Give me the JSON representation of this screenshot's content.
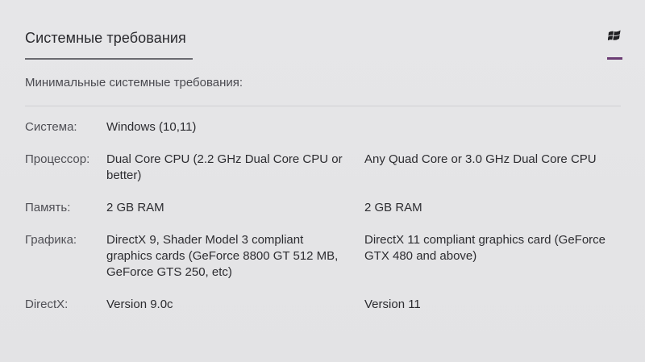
{
  "header": {
    "title": "Системные требования",
    "platform_icon": "windows-icon"
  },
  "colors": {
    "accent": "#6b3c73",
    "title_underline": "#6a6a70",
    "background": "#e4e4e6"
  },
  "subtitle": "Минимальные системные требования:",
  "rows": [
    {
      "label": "Система:",
      "min": "Windows (10,11)",
      "rec": ""
    },
    {
      "label": "Процессор:",
      "min": "Dual Core CPU (2.2 GHz Dual Core CPU or better)",
      "rec": "Any Quad Core or 3.0 GHz Dual Core CPU"
    },
    {
      "label": "Память:",
      "min": "2 GB RAM",
      "rec": "2 GB RAM"
    },
    {
      "label": "Графика:",
      "min": "DirectX 9, Shader Model 3 compliant graphics cards (GeForce 8800 GT 512 MB, GeForce GTS 250, etc)",
      "rec": "DirectX 11 compliant graphics card (GeForce GTX 480 and above)"
    },
    {
      "label": "DirectX:",
      "min": "Version 9.0c",
      "rec": "Version 11"
    }
  ]
}
